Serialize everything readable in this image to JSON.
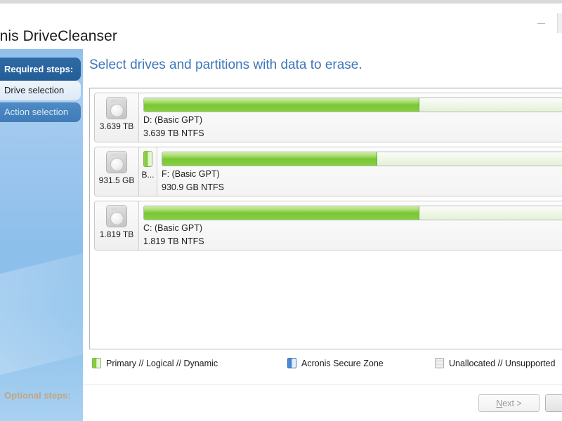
{
  "window": {
    "app_title": "Acronis DriveCleanser",
    "controls": [
      {
        "name": "minimize",
        "glyph": "minimize-icon"
      }
    ]
  },
  "sidebar": {
    "required_header": "Required steps:",
    "items": [
      {
        "label": "Drive selection",
        "state": "active"
      },
      {
        "label": "Action selection",
        "state": "pending"
      }
    ],
    "optional_header": "Optional steps:"
  },
  "main": {
    "heading": "Select drives and partitions with data to erase.",
    "drives": [
      {
        "disk_size": "3.639 TB",
        "mini_partition": null,
        "partition_title": "D: (Basic GPT)",
        "partition_sub": "3.639 TB  NTFS",
        "fill_percent": 65
      },
      {
        "disk_size": "931.5 GB",
        "mini_partition": {
          "label": "B...",
          "fill_percent": 46
        },
        "partition_title": "F: (Basic GPT)",
        "partition_sub": "930.9 GB  NTFS",
        "fill_percent": 53
      },
      {
        "disk_size": "1.819 TB",
        "mini_partition": null,
        "partition_title": "C: (Basic GPT)",
        "partition_sub": "1.819 TB  NTFS",
        "fill_percent": 65
      }
    ]
  },
  "legend": [
    {
      "label": "Primary // Logical // Dynamic",
      "swatch": "green-partition-icon"
    },
    {
      "label": "Acronis Secure Zone",
      "swatch": "blue-partition-icon"
    },
    {
      "label": "Unallocated // Unsupported",
      "swatch": "grey-hatched-icon"
    }
  ],
  "footer": {
    "next_label_prefix": "",
    "next_label_accel": "N",
    "next_label_rest": "ext >",
    "cancel_label": ""
  },
  "colors": {
    "accent_blue": "#3d76b8",
    "sidebar_blue": "#8dbfeb",
    "partition_green": "#7cc93a",
    "header_navy": "#235d96"
  }
}
